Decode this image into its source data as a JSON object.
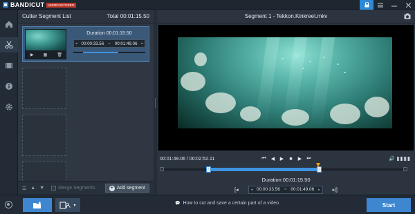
{
  "app": {
    "logo_text": "BANDICUT",
    "badge": "UNREGISTERED",
    "accent": "#2d89d6"
  },
  "titlebar": {
    "controls": [
      {
        "name": "lock-icon",
        "glyph": "🔒"
      },
      {
        "name": "menu-icon",
        "glyph": "☰"
      },
      {
        "name": "minimize-icon",
        "glyph": "–"
      },
      {
        "name": "close-icon",
        "glyph": "✕"
      }
    ]
  },
  "rail": {
    "items": [
      "home-icon",
      "cut-icon",
      "film-icon",
      "info-icon",
      "settings-icon"
    ]
  },
  "segments": {
    "title": "Cutter Segment List",
    "total": "Total 00:01:15.50",
    "active": {
      "duration": "Duration 00:01:15.50",
      "start": "00:00:33.56",
      "end": "00:01:49.06",
      "separator": "~",
      "progress": 0.55
    },
    "footer": {
      "merge_label": "Merge Segments",
      "add_label": "Add segment"
    }
  },
  "player": {
    "title": "Segment 1 - Tekkon.Kinkreet.mkv",
    "position": "00:01:49.06 / 00:02:52.11",
    "duration": "Duration 00:01:15.50",
    "start": "00:00:33.56",
    "end": "00:01:49.06",
    "separator": "~",
    "controls": [
      "⏮",
      "◀",
      "▶",
      "■",
      "▶▶",
      "⏭"
    ]
  },
  "bottom": {
    "hint": "How to cut and save a certain part of a video.",
    "start_label": "Start"
  }
}
